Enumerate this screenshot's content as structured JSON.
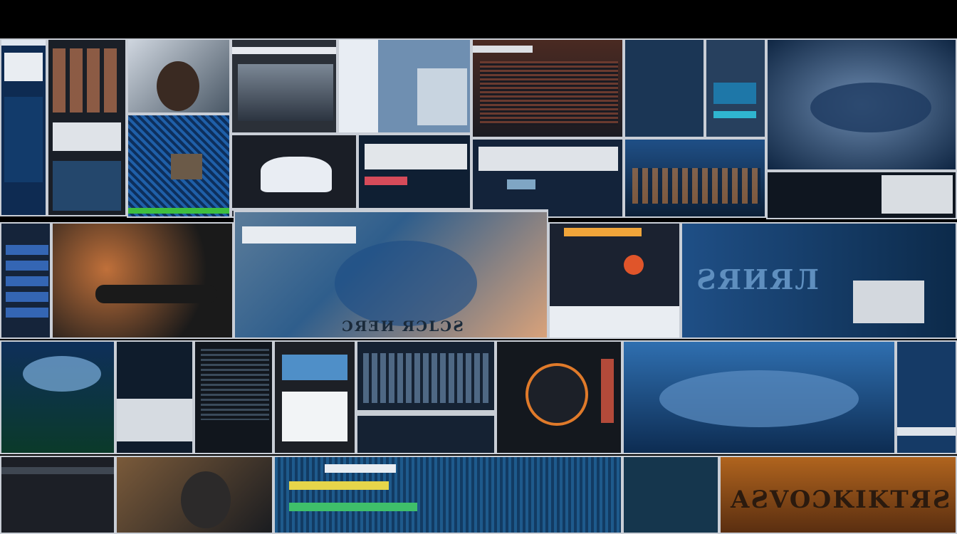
{
  "collage": {
    "overlay_text_1": "ƧЯИЯЛ",
    "overlay_text_2": "AƧVOƆKIKTЯƧ",
    "overlay_text_3": "ƆЯƎИ ЯƆLƆƧ"
  },
  "palette": {
    "background": "#000000",
    "frame": "#c9ced6",
    "deep_blue": "#0b2a4a",
    "accent_blue": "#2f7fd0",
    "warm_orange": "#e07a2a"
  }
}
